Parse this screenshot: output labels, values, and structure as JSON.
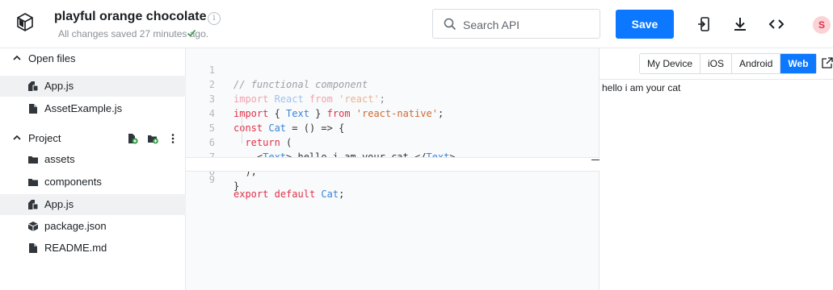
{
  "header": {
    "project_title": "playful orange chocolate",
    "info_glyph": "i",
    "saved_status": "All changes saved 27 minutes ago.",
    "search_placeholder": "Search API",
    "save_label": "Save",
    "avatar_initial": "S",
    "accent_color": "#0b78ff",
    "icons": [
      "snack-logo-icon",
      "info-icon",
      "check-icon",
      "search-icon",
      "device-login-icon",
      "download-icon",
      "embed-code-icon",
      "avatar"
    ]
  },
  "sidebar": {
    "open_files_label": "Open files",
    "open_files": [
      {
        "label": "App.js",
        "icon": "js-file-icon",
        "selected": true
      },
      {
        "label": "AssetExample.js",
        "icon": "file-icon",
        "selected": false
      }
    ],
    "project_label": "Project",
    "project_actions": [
      "new-file-icon",
      "new-folder-icon",
      "more-options-icon"
    ],
    "project_items": [
      {
        "label": "assets",
        "icon": "folder-icon",
        "selected": false
      },
      {
        "label": "components",
        "icon": "folder-icon",
        "selected": false
      },
      {
        "label": "App.js",
        "icon": "js-file-icon",
        "selected": true
      },
      {
        "label": "package.json",
        "icon": "package-icon",
        "selected": false
      },
      {
        "label": "README.md",
        "icon": "file-icon",
        "selected": false
      }
    ]
  },
  "editor": {
    "active_line": 9,
    "lines": [
      {
        "n": "1",
        "text": "// functional component"
      },
      {
        "n": "2",
        "text": "import React from 'react';"
      },
      {
        "n": "3",
        "text": "import { Text } from 'react-native';"
      },
      {
        "n": "4",
        "text": "const Cat = () => {"
      },
      {
        "n": "5",
        "text": "  return ("
      },
      {
        "n": "6",
        "text": "    <Text> hello i am your cat </Text>"
      },
      {
        "n": "7",
        "text": "  );"
      },
      {
        "n": "8",
        "text": "}"
      },
      {
        "n": "9",
        "text": "export default Cat;"
      }
    ]
  },
  "preview": {
    "tabs": [
      {
        "label": "My Device",
        "active": false
      },
      {
        "label": "iOS",
        "active": false
      },
      {
        "label": "Android",
        "active": false
      },
      {
        "label": "Web",
        "active": true
      }
    ],
    "output_text": "hello i am your cat"
  }
}
